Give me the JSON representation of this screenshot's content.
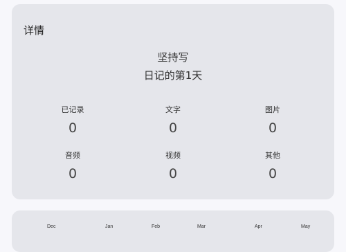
{
  "details": {
    "title": "详情",
    "headline_line1": "坚持写",
    "headline_line2": "日记的第1天",
    "stats": [
      {
        "label": "已记录",
        "value": "0"
      },
      {
        "label": "文字",
        "value": "0"
      },
      {
        "label": "图片",
        "value": "0"
      },
      {
        "label": "音频",
        "value": "0"
      },
      {
        "label": "视频",
        "value": "0"
      },
      {
        "label": "其他",
        "value": "0"
      }
    ]
  },
  "heatmap": {
    "months": [
      "Dec",
      "Jan",
      "Feb",
      "Mar",
      "Apr",
      "May"
    ]
  }
}
